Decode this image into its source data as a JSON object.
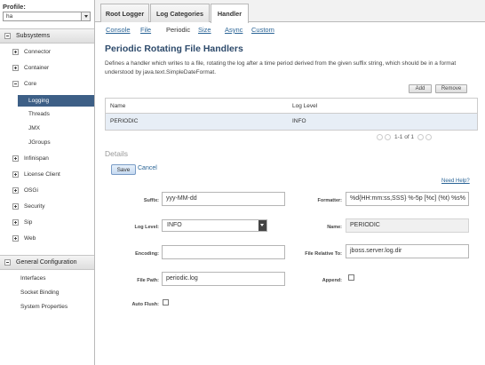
{
  "profile": {
    "label": "Profile:",
    "value": "ha"
  },
  "sidebar": {
    "section1": "Subsystems",
    "items": [
      {
        "label": "Connector"
      },
      {
        "label": "Container"
      },
      {
        "label": "Core"
      }
    ],
    "core_children": [
      {
        "label": "Logging"
      },
      {
        "label": "Threads"
      },
      {
        "label": "JMX"
      },
      {
        "label": "JGroups"
      }
    ],
    "items2": [
      {
        "label": "Infinispan"
      },
      {
        "label": "License Client"
      },
      {
        "label": "OSGi"
      },
      {
        "label": "Security"
      },
      {
        "label": "Sip"
      },
      {
        "label": "Web"
      }
    ],
    "section2": "General Configuration",
    "general_items": [
      {
        "label": "Interfaces"
      },
      {
        "label": "Socket Binding"
      },
      {
        "label": "System Properties"
      }
    ]
  },
  "tabs": [
    {
      "label": "Root Logger"
    },
    {
      "label": "Log Categories"
    },
    {
      "label": "Handler"
    }
  ],
  "subtabs": [
    {
      "label": "Console"
    },
    {
      "label": "File"
    },
    {
      "label": "Periodic"
    },
    {
      "label": "Size"
    },
    {
      "label": "Async"
    },
    {
      "label": "Custom"
    }
  ],
  "page": {
    "title": "Periodic Rotating File Handlers",
    "description": "Defines a handler which writes to a file, rotating the log after a time period derived from the given suffix string, which should be in a format understood by java.text.SimpleDateFormat.",
    "add": "Add",
    "remove": "Remove"
  },
  "table": {
    "columns": [
      "Name",
      "Log Level"
    ],
    "rows": [
      [
        "PERIODIC",
        "INFO"
      ]
    ],
    "pager": "1-1 of 1"
  },
  "details": {
    "title": "Details",
    "save": "Save",
    "cancel": "Cancel",
    "help": "Need Help?",
    "suffix_label": "Suffix:",
    "suffix_value": "yyy-MM-dd",
    "formatter_label": "Formatter:",
    "formatter_value": "%d{HH:mm:ss,SSS} %-5p [%c] (%t) %s%",
    "level_label": "Log Level:",
    "level_value": "INFO",
    "name_label": "Name:",
    "name_value": "PERIODIC",
    "encoding_label": "Encoding:",
    "encoding_value": "",
    "relative_label": "File Relative To:",
    "relative_value": "jboss.server.log.dir",
    "path_label": "File Path:",
    "path_value": "periodic.log",
    "append_label": "Append:",
    "append_checked": false,
    "autoflush_label": "Auto Flush:",
    "autoflush_checked": false
  }
}
